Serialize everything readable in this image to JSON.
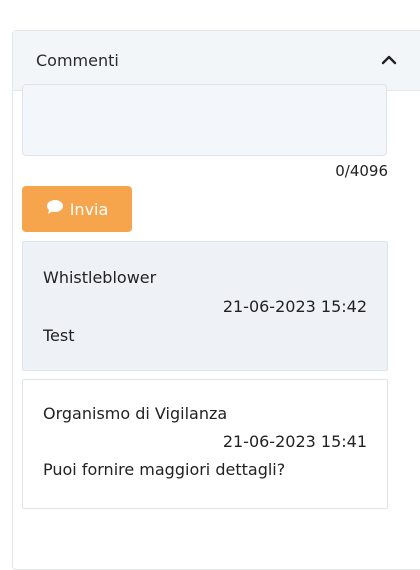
{
  "comments_panel": {
    "title": "Commenti",
    "collapse_icon": "chevron-up-icon",
    "input": {
      "value": "",
      "counter": "0/4096"
    },
    "send_button": {
      "label": "Invia",
      "icon": "speech-bubble-icon",
      "color": "#f6a54c"
    },
    "comments": [
      {
        "author": "Whistleblower",
        "timestamp": "21-06-2023 15:42",
        "text": "Test"
      },
      {
        "author": "Organismo di Vigilanza",
        "timestamp": "21-06-2023 15:41",
        "text": "Puoi fornire maggiori dettagli?"
      }
    ]
  }
}
